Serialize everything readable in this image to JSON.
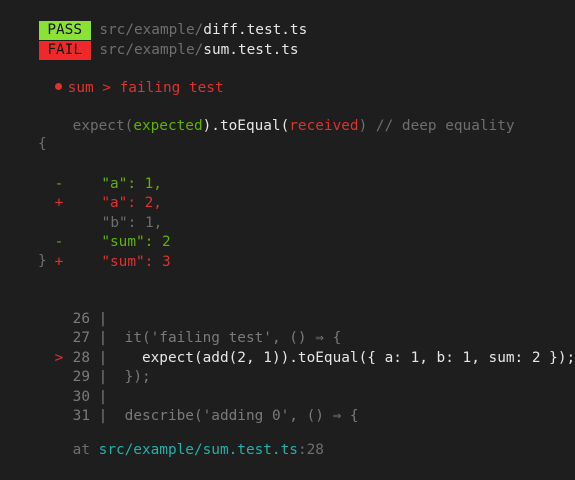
{
  "results": [
    {
      "status": "PASS",
      "path_dir": "src/example/",
      "file": "diff.test.ts"
    },
    {
      "status": "FAIL",
      "path_dir": "src/example/",
      "file": "sum.test.ts"
    }
  ],
  "failure": {
    "title": "sum > failing test"
  },
  "expect_line": {
    "p1": "expect(",
    "expected": "expected",
    "p2": ").toEqual(",
    "received": "received",
    "p3": ")",
    "comment": " // deep equality"
  },
  "diff": {
    "open": "{",
    "close": "}",
    "lines": [
      {
        "marker": "-",
        "text": "\"a\": 1,"
      },
      {
        "marker": "+",
        "text": "\"a\": 2,"
      },
      {
        "marker": "",
        "text": "\"b\": 1,"
      },
      {
        "marker": "-",
        "text": "\"sum\": 2"
      },
      {
        "marker": "+",
        "text": "\"sum\": 3"
      }
    ]
  },
  "code": [
    {
      "arrow": "",
      "num": "26",
      "sep": "|",
      "text": ""
    },
    {
      "arrow": "",
      "num": "27",
      "sep": "|",
      "text": "  it('failing test', () ⇒ {"
    },
    {
      "arrow": ">",
      "num": "28",
      "sep": "|",
      "text": "    expect(add(2, 1)).toEqual({ a: 1, b: 1, sum: 2 });"
    },
    {
      "arrow": "",
      "num": "29",
      "sep": "|",
      "text": "  });"
    },
    {
      "arrow": "",
      "num": "30",
      "sep": "|",
      "text": ""
    },
    {
      "arrow": "",
      "num": "31",
      "sep": "|",
      "text": "  describe('adding 0', () ⇒ {"
    }
  ],
  "location": {
    "prefix": "at ",
    "path": "src/example/sum.test.ts",
    "line": ":28"
  }
}
